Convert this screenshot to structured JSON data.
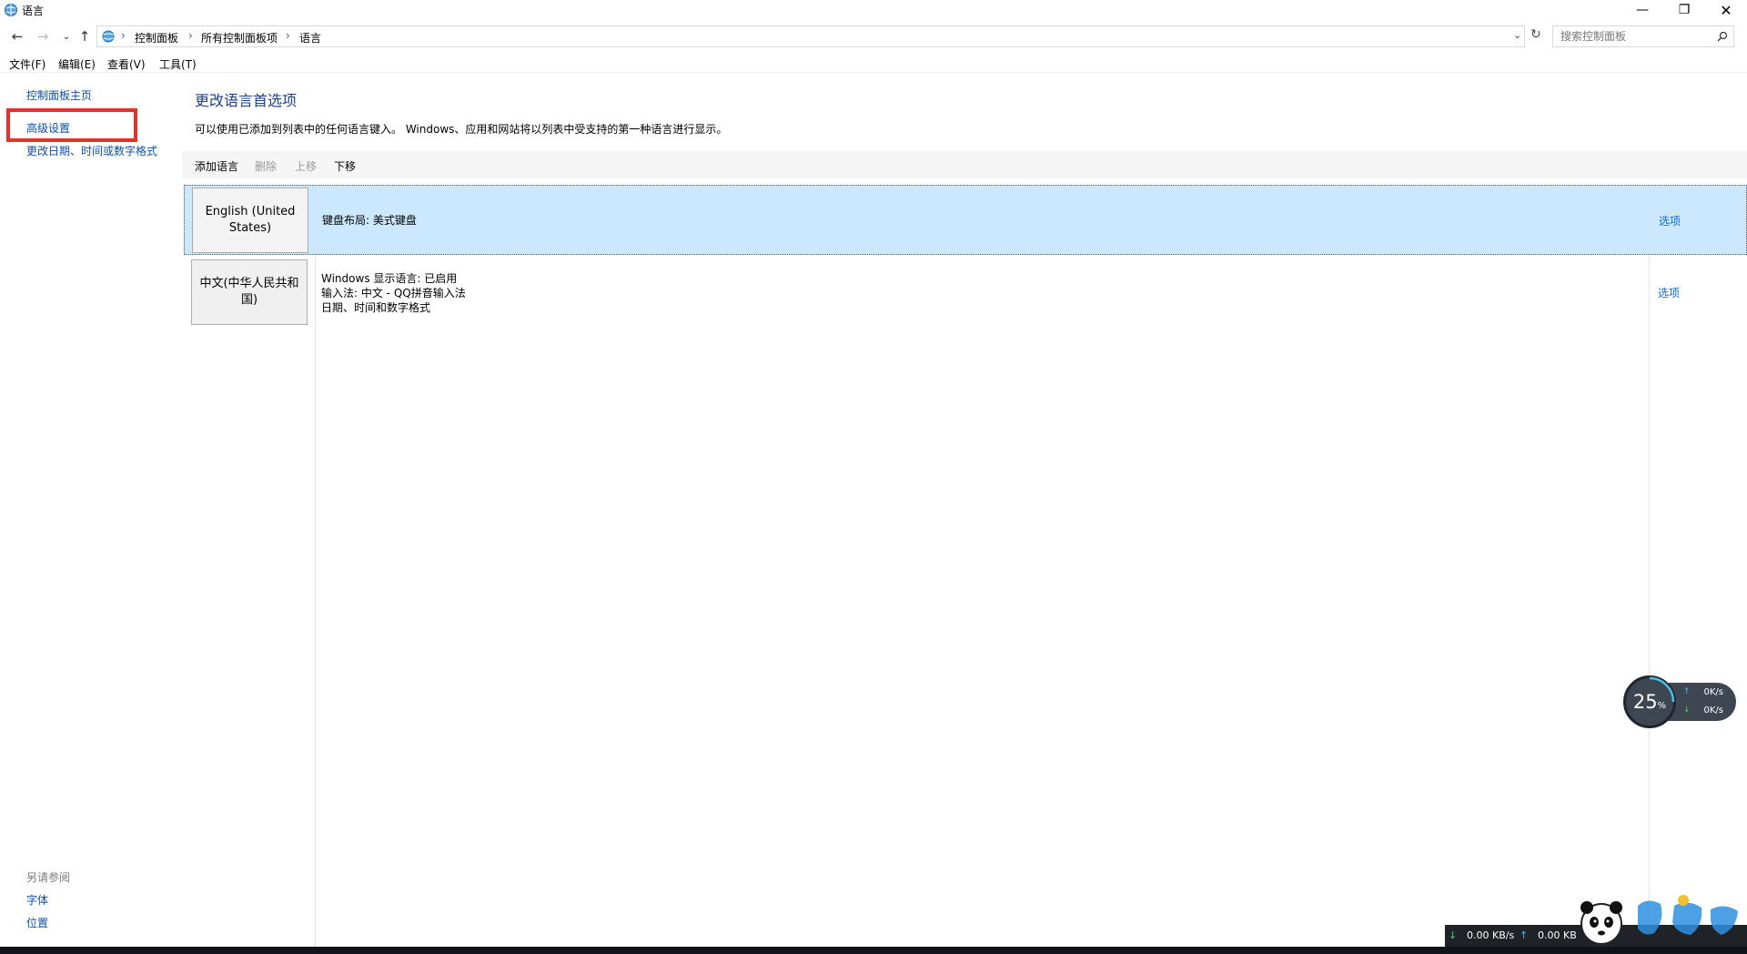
{
  "window": {
    "title": "语言"
  },
  "breadcrumb": {
    "items": [
      "控制面板",
      "所有控制面板项",
      "语言"
    ]
  },
  "search": {
    "placeholder": "搜索控制面板"
  },
  "menu": {
    "items": [
      "文件(F)",
      "编辑(E)",
      "查看(V)",
      "工具(T)"
    ]
  },
  "sidebar": {
    "links": [
      "控制面板主页",
      "高级设置",
      "更改日期、时间或数字格式"
    ],
    "see_also_heading": "另请参阅",
    "see_also_links": [
      "字体",
      "位置"
    ]
  },
  "main": {
    "title": "更改语言首选项",
    "description": "可以使用已添加到列表中的任何语言键入。 Windows、应用和网站将以列表中受支持的第一种语言进行显示。",
    "toolbar": {
      "add": "添加语言",
      "remove": "删除",
      "move_up": "上移",
      "move_down": "下移"
    },
    "languages": [
      {
        "name": "English (United States)",
        "details": [
          "键盘布局: 美式键盘"
        ],
        "options": "选项"
      },
      {
        "name": "中文(中华人民共和国)",
        "details": [
          "Windows 显示语言: 已启用",
          "输入法: 中文 - QQ拼音输入法",
          "日期、时间和数字格式"
        ],
        "options": "选项"
      }
    ]
  },
  "speed_widget": {
    "percent": "25",
    "percent_sign": "%",
    "up": "0K/s",
    "down": "0K/s"
  },
  "netbar": {
    "down": "0.00 KB/s",
    "up": "0.00 KB"
  },
  "colors": {
    "link": "#0b4fa8",
    "selected_row": "#cce8ff",
    "highlight_box": "#e8302a"
  }
}
